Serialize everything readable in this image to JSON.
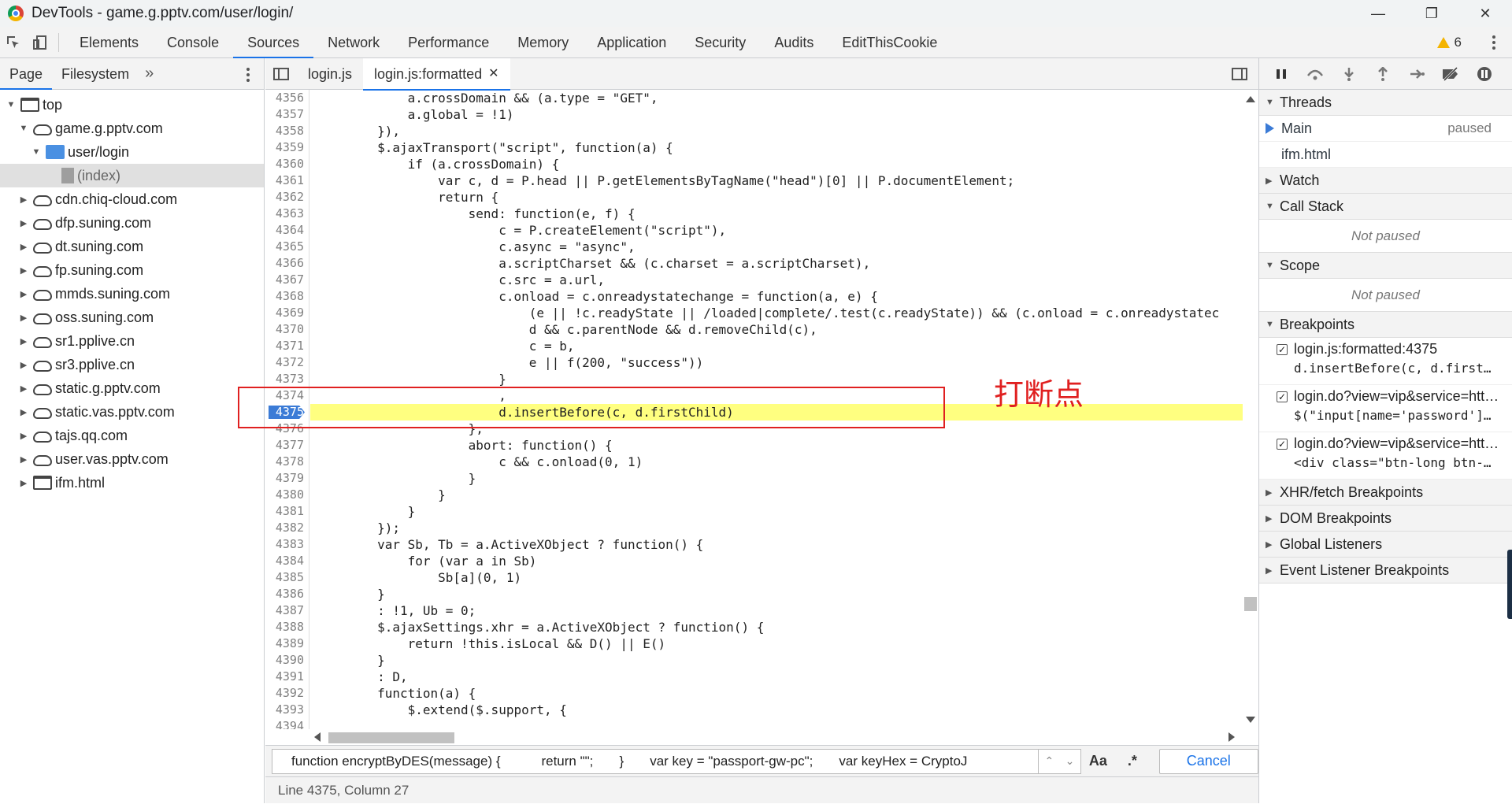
{
  "window": {
    "title": "DevTools - game.g.pptv.com/user/login/",
    "minimize": "—",
    "restore": "❐",
    "close": "✕"
  },
  "main_tabs": [
    "Elements",
    "Console",
    "Sources",
    "Network",
    "Performance",
    "Memory",
    "Application",
    "Security",
    "Audits",
    "EditThisCookie"
  ],
  "active_main_tab": "Sources",
  "warnings_count": "6",
  "navigator": {
    "tabs": [
      "Page",
      "Filesystem"
    ],
    "more": "»",
    "tree": [
      {
        "label": "top",
        "icon": "frame-icon",
        "indent": 0,
        "arrow": "▼"
      },
      {
        "label": "game.g.pptv.com",
        "icon": "cloud-icon",
        "indent": 1,
        "arrow": "▼"
      },
      {
        "label": "user/login",
        "icon": "folder-icon",
        "indent": 2,
        "arrow": "▼"
      },
      {
        "label": "(index)",
        "icon": "file-icon",
        "indent": 3,
        "arrow": "",
        "selected": true
      },
      {
        "label": "cdn.chiq-cloud.com",
        "icon": "cloud-icon",
        "indent": 1,
        "arrow": "▶"
      },
      {
        "label": "dfp.suning.com",
        "icon": "cloud-icon",
        "indent": 1,
        "arrow": "▶"
      },
      {
        "label": "dt.suning.com",
        "icon": "cloud-icon",
        "indent": 1,
        "arrow": "▶"
      },
      {
        "label": "fp.suning.com",
        "icon": "cloud-icon",
        "indent": 1,
        "arrow": "▶"
      },
      {
        "label": "mmds.suning.com",
        "icon": "cloud-icon",
        "indent": 1,
        "arrow": "▶"
      },
      {
        "label": "oss.suning.com",
        "icon": "cloud-icon",
        "indent": 1,
        "arrow": "▶"
      },
      {
        "label": "sr1.pplive.cn",
        "icon": "cloud-icon",
        "indent": 1,
        "arrow": "▶"
      },
      {
        "label": "sr3.pplive.cn",
        "icon": "cloud-icon",
        "indent": 1,
        "arrow": "▶"
      },
      {
        "label": "static.g.pptv.com",
        "icon": "cloud-icon",
        "indent": 1,
        "arrow": "▶"
      },
      {
        "label": "static.vas.pptv.com",
        "icon": "cloud-icon",
        "indent": 1,
        "arrow": "▶"
      },
      {
        "label": "tajs.qq.com",
        "icon": "cloud-icon",
        "indent": 1,
        "arrow": "▶"
      },
      {
        "label": "user.vas.pptv.com",
        "icon": "cloud-icon",
        "indent": 1,
        "arrow": "▶"
      },
      {
        "label": "ifm.html",
        "icon": "frame-icon",
        "indent": 1,
        "arrow": "▶"
      }
    ]
  },
  "editor": {
    "tabs": [
      {
        "label": "login.js",
        "active": false,
        "closable": false
      },
      {
        "label": "login.js:formatted",
        "active": true,
        "closable": true
      }
    ],
    "breakpoint_line": 4375,
    "lines": [
      {
        "n": 4356,
        "code": "            a.crossDomain && (a.type = \"GET\","
      },
      {
        "n": 4357,
        "code": "            a.global = !1)"
      },
      {
        "n": 4358,
        "code": "        }),"
      },
      {
        "n": 4359,
        "code": "        $.ajaxTransport(\"script\", function(a) {"
      },
      {
        "n": 4360,
        "code": "            if (a.crossDomain) {"
      },
      {
        "n": 4361,
        "code": "                var c, d = P.head || P.getElementsByTagName(\"head\")[0] || P.documentElement;"
      },
      {
        "n": 4362,
        "code": "                return {"
      },
      {
        "n": 4363,
        "code": "                    send: function(e, f) {"
      },
      {
        "n": 4364,
        "code": "                        c = P.createElement(\"script\"),"
      },
      {
        "n": 4365,
        "code": "                        c.async = \"async\","
      },
      {
        "n": 4366,
        "code": "                        a.scriptCharset && (c.charset = a.scriptCharset),"
      },
      {
        "n": 4367,
        "code": "                        c.src = a.url,"
      },
      {
        "n": 4368,
        "code": "                        c.onload = c.onreadystatechange = function(a, e) {"
      },
      {
        "n": 4369,
        "code": "                            (e || !c.readyState || /loaded|complete/.test(c.readyState)) && (c.onload = c.onreadystatec"
      },
      {
        "n": 4370,
        "code": "                            d && c.parentNode && d.removeChild(c),"
      },
      {
        "n": 4371,
        "code": "                            c = b,"
      },
      {
        "n": 4372,
        "code": "                            e || f(200, \"success\"))"
      },
      {
        "n": 4373,
        "code": "                        }"
      },
      {
        "n": 4374,
        "code": "                        ,"
      },
      {
        "n": 4375,
        "code": "                        d.insertBefore(c, d.firstChild)"
      },
      {
        "n": 4376,
        "code": "                    },"
      },
      {
        "n": 4377,
        "code": "                    abort: function() {"
      },
      {
        "n": 4378,
        "code": "                        c && c.onload(0, 1)"
      },
      {
        "n": 4379,
        "code": "                    }"
      },
      {
        "n": 4380,
        "code": "                }"
      },
      {
        "n": 4381,
        "code": "            }"
      },
      {
        "n": 4382,
        "code": "        });"
      },
      {
        "n": 4383,
        "code": "        var Sb, Tb = a.ActiveXObject ? function() {"
      },
      {
        "n": 4384,
        "code": "            for (var a in Sb)"
      },
      {
        "n": 4385,
        "code": "                Sb[a](0, 1)"
      },
      {
        "n": 4386,
        "code": "        }"
      },
      {
        "n": 4387,
        "code": "        : !1, Ub = 0;"
      },
      {
        "n": 4388,
        "code": "        $.ajaxSettings.xhr = a.ActiveXObject ? function() {"
      },
      {
        "n": 4389,
        "code": "            return !this.isLocal && D() || E()"
      },
      {
        "n": 4390,
        "code": "        }"
      },
      {
        "n": 4391,
        "code": "        : D,"
      },
      {
        "n": 4392,
        "code": "        function(a) {"
      },
      {
        "n": 4393,
        "code": "            $.extend($.support, {"
      },
      {
        "n": 4394,
        "code": ""
      }
    ]
  },
  "annotation": "打断点",
  "search": {
    "value": "function encryptByDES(message) {           return \"\";       }       var key = \"passport-gw-pc\";       var keyHex = CryptoJ",
    "prev": "⌃",
    "next": "⌄",
    "match_case": "Aa",
    "regex": ".*",
    "cancel": "Cancel"
  },
  "status": "Line 4375, Column 27",
  "debugger": {
    "threads_title": "Threads",
    "threads": [
      {
        "name": "Main",
        "state": "paused",
        "current": true
      },
      {
        "name": "ifm.html",
        "state": "",
        "current": false
      }
    ],
    "watch_title": "Watch",
    "callstack_title": "Call Stack",
    "callstack_empty": "Not paused",
    "scope_title": "Scope",
    "scope_empty": "Not paused",
    "breakpoints_title": "Breakpoints",
    "breakpoints": [
      {
        "file": "login.js:formatted:4375",
        "code": "d.insertBefore(c, d.first…"
      },
      {
        "file": "login.do?view=vip&service=htt…",
        "code": "$(\"input[name='password']…"
      },
      {
        "file": "login.do?view=vip&service=htt…",
        "code": "<div class=\"btn-long btn-…"
      }
    ],
    "xhr_title": "XHR/fetch Breakpoints",
    "dom_title": "DOM Breakpoints",
    "global_title": "Global Listeners",
    "event_title": "Event Listener Breakpoints"
  }
}
